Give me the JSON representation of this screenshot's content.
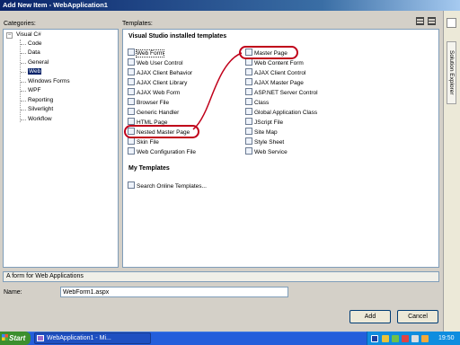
{
  "window": {
    "title": "Add New Item - WebApplication1"
  },
  "categories": {
    "label": "Categories:",
    "root": "Visual C#",
    "root_expander": "−",
    "items": [
      "Code",
      "Data",
      "General",
      "Web",
      "Windows Forms",
      "WPF",
      "Reporting",
      "Silverlight",
      "Workflow"
    ],
    "selected": "Web"
  },
  "templates": {
    "label": "Templates:",
    "installed_header": "Visual Studio installed templates",
    "left_column": [
      "Web Form",
      "Web User Control",
      "AJAX Client Behavior",
      "AJAX Client Library",
      "AJAX Web Form",
      "Browser File",
      "Generic Handler",
      "HTML Page",
      "Nested Master Page",
      "Skin File",
      "Web Configuration File"
    ],
    "right_column": [
      "Master Page",
      "Web Content Form",
      "AJAX Client Control",
      "AJAX Master Page",
      "ASP.NET Server Control",
      "Class",
      "Global Application Class",
      "JScript File",
      "Site Map",
      "Style Sheet",
      "Web Service"
    ],
    "selected": "Web Form",
    "highlighted": [
      "Master Page",
      "Nested Master Page"
    ],
    "my_templates_header": "My Templates",
    "search_online": "Search Online Templates..."
  },
  "description": "A form for Web Applications",
  "name_field": {
    "label": "Name:",
    "value": "WebForm1.aspx"
  },
  "buttons": {
    "add": "Add",
    "cancel": "Cancel"
  },
  "side_panel": {
    "label": "Solution Explorer"
  },
  "taskbar": {
    "start_label": "Start",
    "window_button": "WebApplication1 - Mi...",
    "clock": "19:50"
  },
  "colors": {
    "selection": "#0a246a",
    "highlight_oval": "#c0001a",
    "titlebar": "#0a246a",
    "taskbar": "#245edb"
  }
}
